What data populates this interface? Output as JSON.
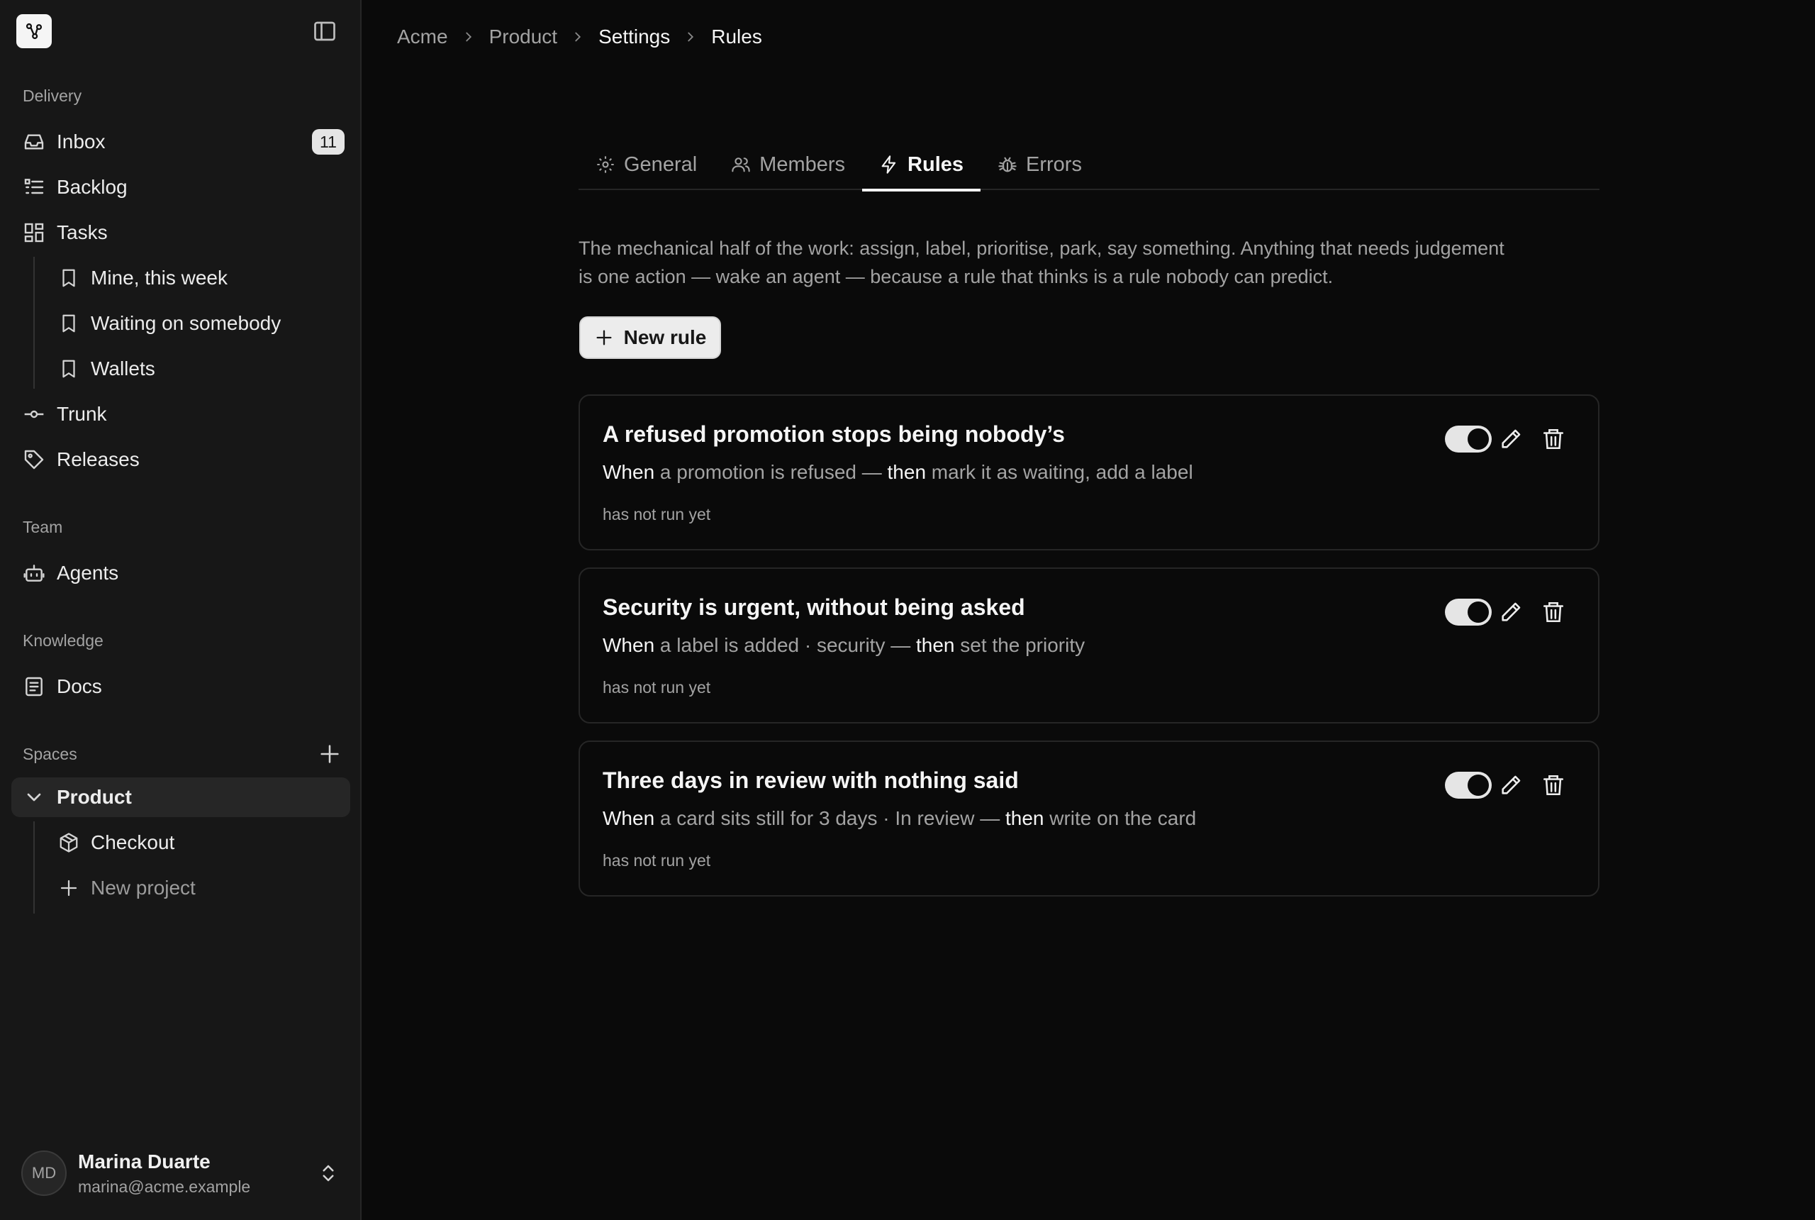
{
  "sidebar": {
    "sections": {
      "delivery": "Delivery",
      "team": "Team",
      "knowledge": "Knowledge",
      "spaces": "Spaces"
    },
    "items": {
      "inbox": {
        "label": "Inbox",
        "badge": "11",
        "icon": "inbox-icon"
      },
      "backlog": {
        "label": "Backlog",
        "icon": "list-icon"
      },
      "tasks": {
        "label": "Tasks",
        "icon": "grid-icon"
      },
      "mine": {
        "label": "Mine, this week",
        "icon": "bookmark-icon"
      },
      "waiting": {
        "label": "Waiting on somebody",
        "icon": "bookmark-icon"
      },
      "wallets": {
        "label": "Wallets",
        "icon": "bookmark-icon"
      },
      "trunk": {
        "label": "Trunk",
        "icon": "commit-icon"
      },
      "releases": {
        "label": "Releases",
        "icon": "tag-icon"
      },
      "agents": {
        "label": "Agents",
        "icon": "bot-icon"
      },
      "docs": {
        "label": "Docs",
        "icon": "file-text-icon"
      },
      "product": {
        "label": "Product",
        "icon": "chevron-down-icon"
      },
      "checkout": {
        "label": "Checkout",
        "icon": "package-icon"
      },
      "new_project": {
        "label": "New project",
        "icon": "plus-icon"
      }
    },
    "user": {
      "initials": "MD",
      "name": "Marina Duarte",
      "email": "marina@acme.example"
    }
  },
  "breadcrumb": [
    "Acme",
    "Product",
    "Settings",
    "Rules"
  ],
  "tabs": [
    {
      "label": "General",
      "icon": "gear-icon"
    },
    {
      "label": "Members",
      "icon": "users-icon"
    },
    {
      "label": "Rules",
      "icon": "zap-icon",
      "active": true
    },
    {
      "label": "Errors",
      "icon": "bug-icon"
    }
  ],
  "description": "The mechanical half of the work: assign, label, prioritise, park, say something. Anything that needs judgement is one action — wake an agent — because a rule that thinks is a rule nobody can predict.",
  "new_rule_label": "New rule",
  "rules": [
    {
      "title": "A refused promotion stops being nobody’s",
      "when_kw": "When",
      "trigger": " a promotion is refused — ",
      "then_kw": "then",
      "action": " mark it as waiting, add a label",
      "status": "has not run yet",
      "enabled": true
    },
    {
      "title": "Security is urgent, without being asked",
      "when_kw": "When",
      "trigger": " a label is added · security — ",
      "then_kw": "then",
      "action": " set the priority",
      "status": "has not run yet",
      "enabled": true
    },
    {
      "title": "Three days in review with nothing said",
      "when_kw": "When",
      "trigger": " a card sits still for 3 days · In review — ",
      "then_kw": "then",
      "action": " write on the card",
      "status": "has not run yet",
      "enabled": true
    }
  ]
}
